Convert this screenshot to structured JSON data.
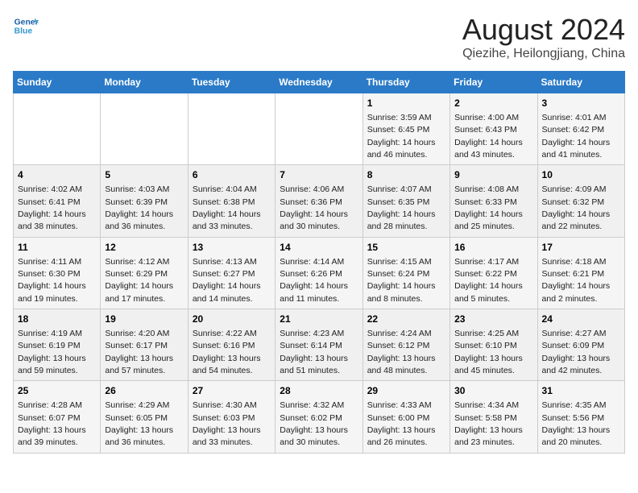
{
  "header": {
    "logo_line1": "General",
    "logo_line2": "Blue",
    "title": "August 2024",
    "subtitle": "Qiezihe, Heilongjiang, China"
  },
  "weekdays": [
    "Sunday",
    "Monday",
    "Tuesday",
    "Wednesday",
    "Thursday",
    "Friday",
    "Saturday"
  ],
  "weeks": [
    [
      {
        "day": "",
        "info": ""
      },
      {
        "day": "",
        "info": ""
      },
      {
        "day": "",
        "info": ""
      },
      {
        "day": "",
        "info": ""
      },
      {
        "day": "1",
        "info": "Sunrise: 3:59 AM\nSunset: 6:45 PM\nDaylight: 14 hours\nand 46 minutes."
      },
      {
        "day": "2",
        "info": "Sunrise: 4:00 AM\nSunset: 6:43 PM\nDaylight: 14 hours\nand 43 minutes."
      },
      {
        "day": "3",
        "info": "Sunrise: 4:01 AM\nSunset: 6:42 PM\nDaylight: 14 hours\nand 41 minutes."
      }
    ],
    [
      {
        "day": "4",
        "info": "Sunrise: 4:02 AM\nSunset: 6:41 PM\nDaylight: 14 hours\nand 38 minutes."
      },
      {
        "day": "5",
        "info": "Sunrise: 4:03 AM\nSunset: 6:39 PM\nDaylight: 14 hours\nand 36 minutes."
      },
      {
        "day": "6",
        "info": "Sunrise: 4:04 AM\nSunset: 6:38 PM\nDaylight: 14 hours\nand 33 minutes."
      },
      {
        "day": "7",
        "info": "Sunrise: 4:06 AM\nSunset: 6:36 PM\nDaylight: 14 hours\nand 30 minutes."
      },
      {
        "day": "8",
        "info": "Sunrise: 4:07 AM\nSunset: 6:35 PM\nDaylight: 14 hours\nand 28 minutes."
      },
      {
        "day": "9",
        "info": "Sunrise: 4:08 AM\nSunset: 6:33 PM\nDaylight: 14 hours\nand 25 minutes."
      },
      {
        "day": "10",
        "info": "Sunrise: 4:09 AM\nSunset: 6:32 PM\nDaylight: 14 hours\nand 22 minutes."
      }
    ],
    [
      {
        "day": "11",
        "info": "Sunrise: 4:11 AM\nSunset: 6:30 PM\nDaylight: 14 hours\nand 19 minutes."
      },
      {
        "day": "12",
        "info": "Sunrise: 4:12 AM\nSunset: 6:29 PM\nDaylight: 14 hours\nand 17 minutes."
      },
      {
        "day": "13",
        "info": "Sunrise: 4:13 AM\nSunset: 6:27 PM\nDaylight: 14 hours\nand 14 minutes."
      },
      {
        "day": "14",
        "info": "Sunrise: 4:14 AM\nSunset: 6:26 PM\nDaylight: 14 hours\nand 11 minutes."
      },
      {
        "day": "15",
        "info": "Sunrise: 4:15 AM\nSunset: 6:24 PM\nDaylight: 14 hours\nand 8 minutes."
      },
      {
        "day": "16",
        "info": "Sunrise: 4:17 AM\nSunset: 6:22 PM\nDaylight: 14 hours\nand 5 minutes."
      },
      {
        "day": "17",
        "info": "Sunrise: 4:18 AM\nSunset: 6:21 PM\nDaylight: 14 hours\nand 2 minutes."
      }
    ],
    [
      {
        "day": "18",
        "info": "Sunrise: 4:19 AM\nSunset: 6:19 PM\nDaylight: 13 hours\nand 59 minutes."
      },
      {
        "day": "19",
        "info": "Sunrise: 4:20 AM\nSunset: 6:17 PM\nDaylight: 13 hours\nand 57 minutes."
      },
      {
        "day": "20",
        "info": "Sunrise: 4:22 AM\nSunset: 6:16 PM\nDaylight: 13 hours\nand 54 minutes."
      },
      {
        "day": "21",
        "info": "Sunrise: 4:23 AM\nSunset: 6:14 PM\nDaylight: 13 hours\nand 51 minutes."
      },
      {
        "day": "22",
        "info": "Sunrise: 4:24 AM\nSunset: 6:12 PM\nDaylight: 13 hours\nand 48 minutes."
      },
      {
        "day": "23",
        "info": "Sunrise: 4:25 AM\nSunset: 6:10 PM\nDaylight: 13 hours\nand 45 minutes."
      },
      {
        "day": "24",
        "info": "Sunrise: 4:27 AM\nSunset: 6:09 PM\nDaylight: 13 hours\nand 42 minutes."
      }
    ],
    [
      {
        "day": "25",
        "info": "Sunrise: 4:28 AM\nSunset: 6:07 PM\nDaylight: 13 hours\nand 39 minutes."
      },
      {
        "day": "26",
        "info": "Sunrise: 4:29 AM\nSunset: 6:05 PM\nDaylight: 13 hours\nand 36 minutes."
      },
      {
        "day": "27",
        "info": "Sunrise: 4:30 AM\nSunset: 6:03 PM\nDaylight: 13 hours\nand 33 minutes."
      },
      {
        "day": "28",
        "info": "Sunrise: 4:32 AM\nSunset: 6:02 PM\nDaylight: 13 hours\nand 30 minutes."
      },
      {
        "day": "29",
        "info": "Sunrise: 4:33 AM\nSunset: 6:00 PM\nDaylight: 13 hours\nand 26 minutes."
      },
      {
        "day": "30",
        "info": "Sunrise: 4:34 AM\nSunset: 5:58 PM\nDaylight: 13 hours\nand 23 minutes."
      },
      {
        "day": "31",
        "info": "Sunrise: 4:35 AM\nSunset: 5:56 PM\nDaylight: 13 hours\nand 20 minutes."
      }
    ]
  ]
}
